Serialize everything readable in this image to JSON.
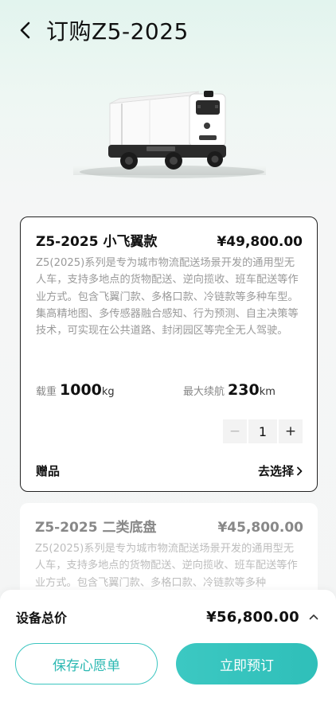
{
  "header": {
    "title": "订购Z5-2025",
    "back_icon": "chevron-left-icon"
  },
  "hero": {
    "image": "delivery-vehicle-image"
  },
  "products": [
    {
      "name": "Z5-2025 小飞翼款",
      "price": "¥49,800.00",
      "description": "Z5(2025)系列是专为城市物流配送场景开发的通用型无人车，支持多地点的货物配送、逆向揽收、班车配送等作业方式。包含飞翼门款、多格口款、冷链款等多种车型。集高精地图、多传感器融合感知、行为预测、自主决策等技术，可实现在公共道路、封闭园区等完全无人驾驶。",
      "specs": {
        "load_label": "载重",
        "load_value": "1000",
        "load_unit": "kg",
        "range_label": "最大续航",
        "range_value": "230",
        "range_unit": "km"
      },
      "stepper": {
        "minus": "−",
        "quantity": "1",
        "plus": "+"
      },
      "gift": {
        "label": "赠品",
        "action": "去选择"
      },
      "selected": true
    },
    {
      "name": "Z5-2025 二类底盘",
      "price": "¥45,800.00",
      "description": "Z5(2025)系列是专为城市物流配送场景开发的通用型无人车，支持多地点的货物配送、逆向揽收、班车配送等作业方式。包含飞翼门款、多格口款、冷链款等多种",
      "selected": false
    }
  ],
  "footer": {
    "total_label": "设备总价",
    "total_value": "¥56,800.00",
    "wishlist_button": "保存心愿单",
    "order_button": "立即预订"
  },
  "colors": {
    "accent": "#3bc5c0",
    "text": "#111111",
    "muted": "#9a9a9a"
  }
}
